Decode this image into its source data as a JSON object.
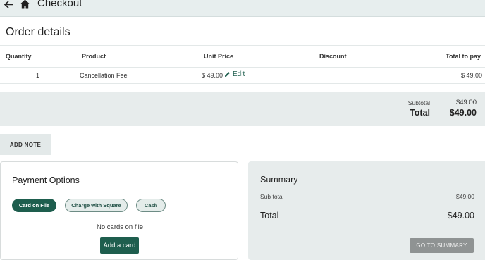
{
  "header": {
    "title": "Checkout",
    "back_icon": "arrow-left-icon",
    "home_icon": "home-icon"
  },
  "order": {
    "title": "Order details",
    "columns": [
      "Quantity",
      "Product",
      "Unit Price",
      "Discount",
      "Total to pay"
    ],
    "rows": [
      {
        "quantity": "1",
        "product": "Cancellation Fee",
        "unit_price": "$ 49.00",
        "edit_label": "Edit",
        "discount": "",
        "total": "$ 49.00"
      }
    ],
    "subtotal_label": "Subtotal",
    "subtotal_value": "$49.00",
    "total_label": "Total",
    "total_value": "$49.00"
  },
  "add_note_label": "ADD NOTE",
  "payment": {
    "title": "Payment Options",
    "options": [
      "Card on File",
      "Charge with Square",
      "Cash"
    ],
    "selected": "Card on File",
    "empty_text": "No cards on file",
    "add_card_label": "Add a card"
  },
  "summary": {
    "title": "Summary",
    "subtotal_label": "Sub total",
    "subtotal_value": "$49.00",
    "total_label": "Total",
    "total_value": "$49.00",
    "button_label": "GO TO SUMMARY"
  },
  "colors": {
    "accent": "#1e5e4e",
    "band": "#e7ecec",
    "disabled_button": "#8f9393"
  }
}
